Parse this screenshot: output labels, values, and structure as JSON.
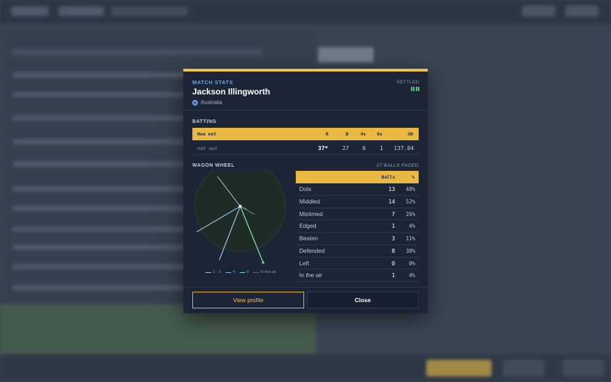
{
  "modal": {
    "eyebrow": "Match stats",
    "player_name": "Jackson Illingworth",
    "country": "Australia",
    "status": "Settled",
    "batting_label": "Batting",
    "batting_headers": {
      "how_out": "How out",
      "runs": "R",
      "balls": "B",
      "fours": "4s",
      "sixes": "6s",
      "strike_rate": "SR"
    },
    "batting_row": {
      "how_out": "not out",
      "runs": "37*",
      "balls": "27",
      "fours": "6",
      "sixes": "1",
      "strike_rate": "137.04"
    },
    "wagon_wheel_label": "Wagon wheel",
    "balls_faced": "27 balls faced",
    "legend": [
      "1 - 3",
      "4",
      "6",
      "in the air"
    ],
    "stats_headers": {
      "balls": "Balls",
      "pct": "%"
    },
    "stats_rows": [
      {
        "label": "Dots",
        "balls": "13",
        "pct": "48%"
      },
      {
        "label": "Middled",
        "balls": "14",
        "pct": "52%"
      },
      {
        "label": "Mistimed",
        "balls": "7",
        "pct": "26%"
      },
      {
        "label": "Edged",
        "balls": "1",
        "pct": "4%"
      },
      {
        "label": "Beaten",
        "balls": "3",
        "pct": "11%"
      },
      {
        "label": "Defended",
        "balls": "8",
        "pct": "30%"
      },
      {
        "label": "Left",
        "balls": "0",
        "pct": "0%"
      },
      {
        "label": "In the air",
        "balls": "1",
        "pct": "4%"
      }
    ],
    "primary_button": "View profile",
    "secondary_button": "Close"
  },
  "colors": {
    "accent": "#f0c24b",
    "status_green": "#4fd08a",
    "shot_1_3": "#9fc8f2",
    "shot_4": "#78b7f0",
    "shot_6": "#7fe0b4"
  },
  "icons": {
    "country_flag": "globe-icon",
    "signal": "signal-bars-icon"
  }
}
